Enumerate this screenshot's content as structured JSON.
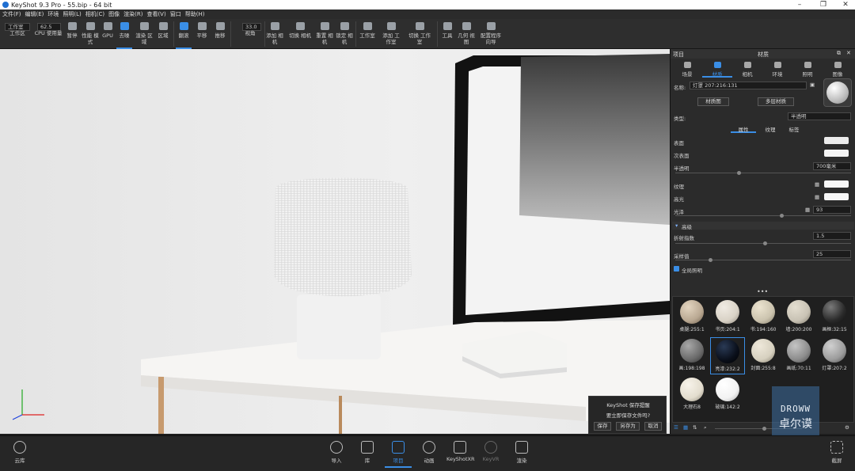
{
  "window": {
    "title": "KeyShot 9.3 Pro  - 55.bip  - 64 bit"
  },
  "menu": [
    "文件(F)",
    "编辑(E)",
    "环境",
    "照明(L)",
    "相机(C)",
    "图像",
    "渲染(R)",
    "查看(V)",
    "窗口",
    "帮助(H)"
  ],
  "toolbar": {
    "workspace_dropdown": "工作室",
    "workspace_label": "工作区",
    "cpu_value": "62.5",
    "cpu_label": "CPU 使用量",
    "pause": "暂停",
    "perf_mode": "性能 模式",
    "gpu": "GPU",
    "denoise": "去噪",
    "render_area": "渲染 区域",
    "region": "区域",
    "tumble": "翻滚",
    "pan": "平移",
    "dolly": "推移",
    "fov_value": "33.0",
    "view_angle": "视角",
    "add_camera": "添加 相机",
    "switch_camera": "切换 相机",
    "reset_camera": "重置 相机",
    "lock_camera": "锁定 相机",
    "studio": "工作室",
    "add_studio": "添加 工作室",
    "switch_studio": "切换 工作室",
    "tools": "工具",
    "geometry_view": "几何 视图",
    "config_wizard": "配置程序 向导"
  },
  "panel": {
    "tabs": [
      "项目",
      "材质"
    ],
    "subtabs": [
      "场景",
      "材质",
      "相机",
      "环境",
      "照明",
      "图像"
    ],
    "name_label": "名称:",
    "name_value": "灯罩 207:216:131",
    "material_graph_btn": "材质图",
    "multi_material_btn": "多层材质",
    "type_label": "类型:",
    "type_value": "半透明",
    "prop_tabs": [
      "属性",
      "纹理",
      "标签"
    ],
    "surface": "表面",
    "subsurface": "次表面",
    "translucency": "半透明",
    "translucency_value": "700毫米",
    "texture": "纹理",
    "specular": "高光",
    "roughness": "光泽",
    "roughness_value": "93",
    "advanced": "高级",
    "ior_label": "折射指数",
    "ior_value": "1.5",
    "samples_label": "采样值",
    "samples_value": "25",
    "global_illum": "全局照明",
    "library": [
      {
        "label": "桌腿:255:1",
        "color": "#b9a892"
      },
      {
        "label": "书页:204:1",
        "color": "#d9d2c6"
      },
      {
        "label": "书:194:160",
        "color": "#cbc3ae"
      },
      {
        "label": "墙:200:200",
        "color": "#c8c2b4"
      },
      {
        "label": "画框:32:15",
        "color": "#2a2a2a"
      },
      {
        "label": "画:198:198",
        "color": "#6b6b6b"
      },
      {
        "label": "亮漆:232:2",
        "color": "#0a0f1a"
      },
      {
        "label": "封面:255:8",
        "color": "#d6d0bf"
      },
      {
        "label": "画纸:70:11",
        "color": "#8c8c8c"
      },
      {
        "label": "灯罩:207:2",
        "color": "#9c9c9c"
      },
      {
        "label": "大理石8",
        "color": "#e3ddce"
      },
      {
        "label": "玻璃:142:2",
        "color": "#f2f2f2"
      }
    ]
  },
  "dialog": {
    "title": "KeyShot 保存提醒",
    "message": "要立即保存文件吗?",
    "save": "保存",
    "save_as": "另存为",
    "cancel": "取消"
  },
  "bottombar": {
    "cloud": "云库",
    "import": "导入",
    "library": "库",
    "project": "项目",
    "animation": "动画",
    "keyshotxr": "KeyShotXR",
    "keyvr": "KeyVR",
    "render": "渲染",
    "screenshot": "截屏"
  },
  "watermark": {
    "line1": "DROWW",
    "line2": "卓尔谟"
  }
}
